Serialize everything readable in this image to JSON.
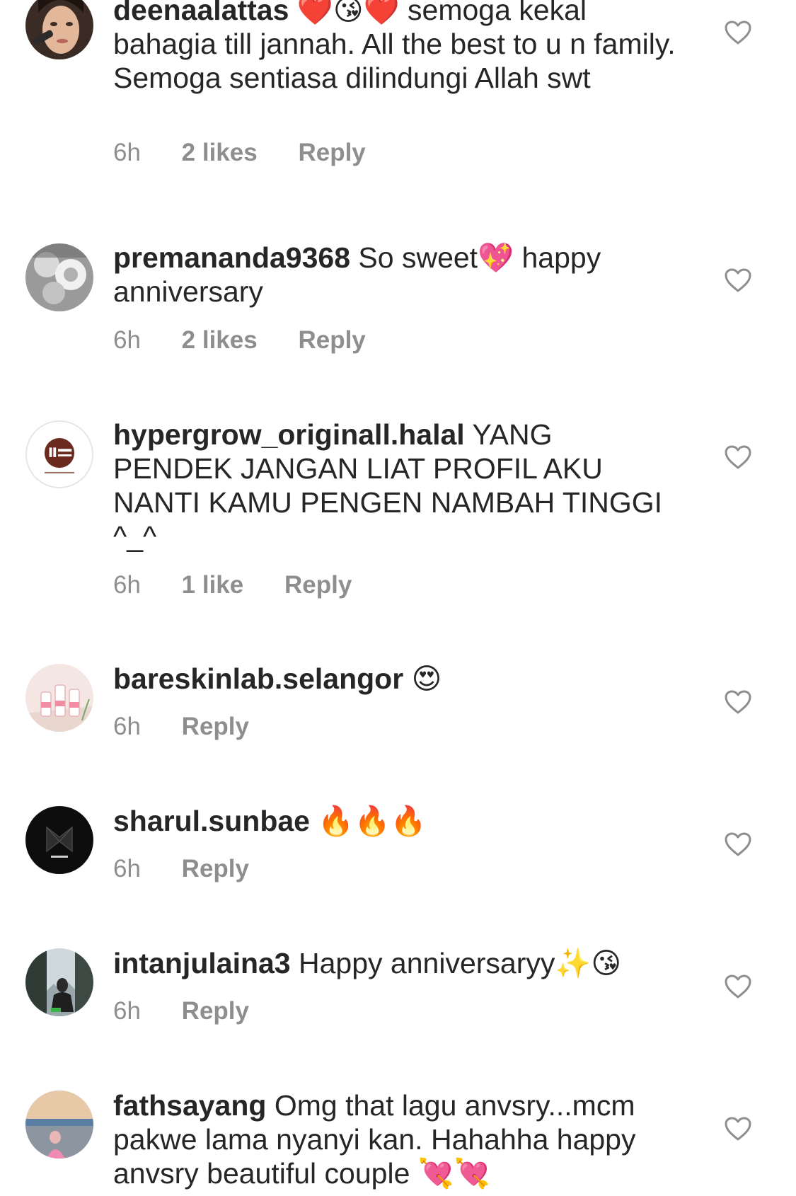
{
  "comments": [
    {
      "username": "deenaalattas",
      "text": "❤️😘❤️ semoga kekal bahagia till jannah. All the best to u n family. Semoga sentiasa dilindungi Allah swt",
      "time": "6h",
      "likes": "2 likes",
      "reply": "Reply",
      "avatar_icon": "makeup-portrait-avatar"
    },
    {
      "username": "premananda9368",
      "text": "So sweet💖 happy anniversary",
      "time": "6h",
      "likes": "2 likes",
      "reply": "Reply",
      "avatar_icon": "grayscale-floral-avatar"
    },
    {
      "username": "hypergrow_originall.halal",
      "text": "YANG PENDEK JANGAN LIAT PROFIL AKU NANTI KAMU PENGEN NAMBAH TINGGI ^_^",
      "time": "6h",
      "likes": "1 like",
      "reply": "Reply",
      "avatar_icon": "hyper-grow-logo-avatar"
    },
    {
      "username": "bareskinlab.selangor",
      "text": "😍",
      "time": "6h",
      "likes": "",
      "reply": "Reply",
      "avatar_icon": "skincare-bottles-avatar"
    },
    {
      "username": "sharul.sunbae",
      "text": "🔥🔥🔥",
      "time": "6h",
      "likes": "",
      "reply": "Reply",
      "avatar_icon": "s-ent-logo-avatar"
    },
    {
      "username": "intanjulaina3",
      "text": "Happy anniversaryy✨😘",
      "time": "6h",
      "likes": "",
      "reply": "Reply",
      "avatar_icon": "window-portrait-avatar"
    },
    {
      "username": "fathsayang",
      "text": "Omg that lagu anvsry...mcm pakwe lama nyanyi kan. Hahahha happy anvsry beautiful couple 💘💘",
      "time": "",
      "likes": "",
      "reply": "",
      "avatar_icon": "sunset-outdoor-avatar"
    }
  ],
  "colors": {
    "text": "#262626",
    "meta": "#8e8e8e",
    "heart_outline": "#8e8e8e"
  }
}
